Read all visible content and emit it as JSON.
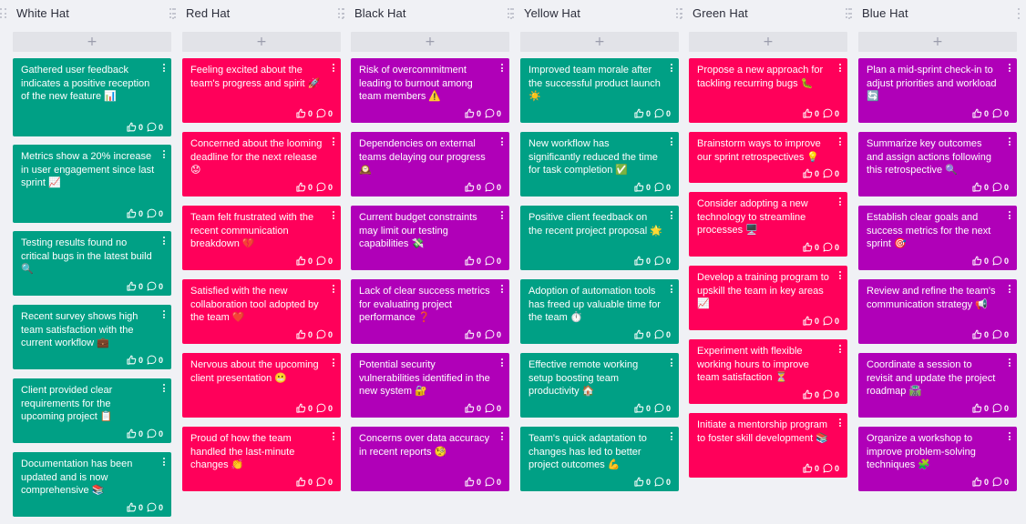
{
  "colors": {
    "background": "#f0f1f5",
    "teal": "#00a085",
    "pink": "#ff005a",
    "purple": "#b000b8",
    "add_button": "#e2e3e8"
  },
  "add_label": "+",
  "columns": [
    {
      "title": "White Hat",
      "color": "#00a085",
      "cards": [
        {
          "text": "Gathered user feedback indicates a positive reception of the new feature 📊",
          "lines": 4,
          "likes": "0",
          "comments": "0"
        },
        {
          "text": "Metrics show a 20% increase in user engagement since last sprint 📈",
          "lines": 4,
          "likes": "0",
          "comments": "0"
        },
        {
          "text": "Testing results found no critical bugs in the latest build 🔍",
          "lines": 3,
          "likes": "0",
          "comments": "0"
        },
        {
          "text": "Recent survey shows high team satisfaction with the current workflow 💼",
          "lines": 3,
          "likes": "0",
          "comments": "0"
        },
        {
          "text": "Client provided clear requirements for the upcoming project 📋",
          "lines": 3,
          "likes": "0",
          "comments": "0"
        },
        {
          "text": "Documentation has been updated and is now comprehensive 📚",
          "lines": 3,
          "likes": "0",
          "comments": "0"
        }
      ]
    },
    {
      "title": "Red Hat",
      "color": "#ff005a",
      "cards": [
        {
          "text": "Feeling excited about the team's progress and spirit 🚀",
          "lines": 3,
          "likes": "0",
          "comments": "0"
        },
        {
          "text": "Concerned about the looming deadline for the next release 😟",
          "lines": 3,
          "likes": "0",
          "comments": "0"
        },
        {
          "text": "Team felt frustrated with the recent communication breakdown 💔",
          "lines": 3,
          "likes": "0",
          "comments": "0"
        },
        {
          "text": "Satisfied with the new collaboration tool adopted by the team ❤️",
          "lines": 3,
          "likes": "0",
          "comments": "0"
        },
        {
          "text": "Nervous about the upcoming client presentation 😬",
          "lines": 3,
          "likes": "0",
          "comments": "0"
        },
        {
          "text": "Proud of how the team handled the last-minute changes 👏",
          "lines": 3,
          "likes": "0",
          "comments": "0"
        }
      ]
    },
    {
      "title": "Black Hat",
      "color": "#b000b8",
      "cards": [
        {
          "text": "Risk of overcommitment leading to burnout among team members ⚠️",
          "lines": 3,
          "likes": "0",
          "comments": "0"
        },
        {
          "text": "Dependencies on external teams delaying our progress 🕰️",
          "lines": 3,
          "likes": "0",
          "comments": "0"
        },
        {
          "text": "Current budget constraints may limit our testing capabilities 💸",
          "lines": 3,
          "likes": "0",
          "comments": "0"
        },
        {
          "text": "Lack of clear success metrics for evaluating project performance ❓",
          "lines": 3,
          "likes": "0",
          "comments": "0"
        },
        {
          "text": "Potential security vulnerabilities identified in the new system 🔐",
          "lines": 3,
          "likes": "0",
          "comments": "0"
        },
        {
          "text": "Concerns over data accuracy in recent reports 🧐",
          "lines": 3,
          "likes": "0",
          "comments": "0"
        }
      ]
    },
    {
      "title": "Yellow Hat",
      "color": "#00a085",
      "cards": [
        {
          "text": "Improved team morale after the successful product launch ☀️",
          "lines": 3,
          "likes": "0",
          "comments": "0"
        },
        {
          "text": "New workflow has significantly reduced the time for task completion ✅",
          "lines": 3,
          "likes": "0",
          "comments": "0"
        },
        {
          "text": "Positive client feedback on the recent project proposal 🌟",
          "lines": 3,
          "likes": "0",
          "comments": "0"
        },
        {
          "text": "Adoption of automation tools has freed up valuable time for the team ⏱️",
          "lines": 3,
          "likes": "0",
          "comments": "0"
        },
        {
          "text": "Effective remote working setup boosting team productivity 🏠",
          "lines": 3,
          "likes": "0",
          "comments": "0"
        },
        {
          "text": "Team's quick adaptation to changes has led to better project outcomes 💪",
          "lines": 3,
          "likes": "0",
          "comments": "0"
        }
      ]
    },
    {
      "title": "Green Hat",
      "color": "#ff005a",
      "cards": [
        {
          "text": "Propose a new approach for tackling recurring bugs 🐛",
          "lines": 3,
          "likes": "0",
          "comments": "0"
        },
        {
          "text": "Brainstorm ways to improve our sprint retrospectives 💡",
          "lines": 2,
          "likes": "0",
          "comments": "0"
        },
        {
          "text": "Consider adopting a new technology to streamline processes 🖥️",
          "lines": 3,
          "likes": "0",
          "comments": "0"
        },
        {
          "text": "Develop a training program to upskill the team in key areas 📈",
          "lines": 3,
          "likes": "0",
          "comments": "0"
        },
        {
          "text": "Experiment with flexible working hours to improve team satisfaction ⏳",
          "lines": 3,
          "likes": "0",
          "comments": "0"
        },
        {
          "text": "Initiate a mentorship program to foster skill development 📚",
          "lines": 3,
          "likes": "0",
          "comments": "0"
        }
      ]
    },
    {
      "title": "Blue Hat",
      "color": "#b000b8",
      "cards": [
        {
          "text": "Plan a mid-sprint check-in to adjust priorities and workload 🔄",
          "lines": 3,
          "likes": "0",
          "comments": "0"
        },
        {
          "text": "Summarize key outcomes and assign actions following this retrospective 🔍",
          "lines": 3,
          "likes": "0",
          "comments": "0"
        },
        {
          "text": "Establish clear goals and success metrics for the next sprint 🎯",
          "lines": 3,
          "likes": "0",
          "comments": "0"
        },
        {
          "text": "Review and refine the team's communication strategy 📢",
          "lines": 3,
          "likes": "0",
          "comments": "0"
        },
        {
          "text": "Coordinate a session to revisit and update the project roadmap 🛣️",
          "lines": 3,
          "likes": "0",
          "comments": "0"
        },
        {
          "text": "Organize a workshop to improve problem-solving techniques 🧩",
          "lines": 3,
          "likes": "0",
          "comments": "0"
        }
      ]
    }
  ]
}
